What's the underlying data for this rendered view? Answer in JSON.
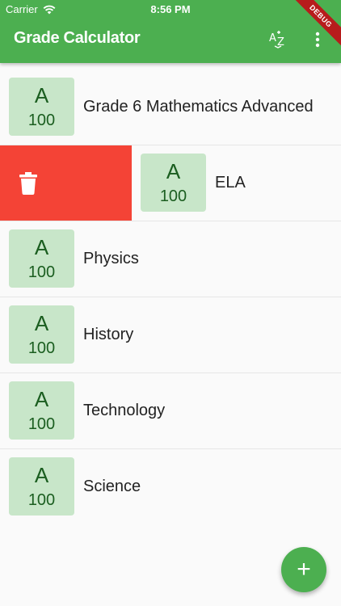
{
  "status_bar": {
    "carrier": "Carrier",
    "time": "8:56 PM"
  },
  "toolbar": {
    "title": "Grade Calculator",
    "sort_icon": "sort-az-icon",
    "more_icon": "more-vert-icon"
  },
  "debug_banner": "DEBUG",
  "courses": [
    {
      "grade": "A",
      "score": "100",
      "name": "Grade 6 Mathematics Advanced"
    },
    {
      "grade": "A",
      "score": "100",
      "name": "ELA",
      "swiped": true
    },
    {
      "grade": "A",
      "score": "100",
      "name": "Physics"
    },
    {
      "grade": "A",
      "score": "100",
      "name": "History"
    },
    {
      "grade": "A",
      "score": "100",
      "name": "Technology"
    },
    {
      "grade": "A",
      "score": "100",
      "name": "Science"
    }
  ],
  "fab": {
    "label": "+",
    "icon": "add-icon"
  },
  "colors": {
    "primary": "#4caf50",
    "badge_bg": "#c8e6c9",
    "badge_text": "#1b5e20",
    "delete": "#f44336"
  }
}
